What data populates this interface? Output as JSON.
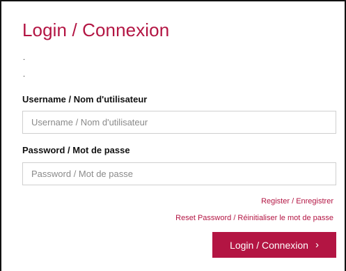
{
  "login": {
    "title": "Login / Connexion",
    "dots": [
      ".",
      "."
    ],
    "username": {
      "label": "Username / Nom d'utilisateur",
      "placeholder": "Username / Nom d'utilisateur",
      "value": ""
    },
    "password": {
      "label": "Password / Mot de passe",
      "placeholder": "Password / Mot de passe",
      "value": ""
    },
    "links": {
      "register": "Register / Enregistrer",
      "reset": "Reset Password / Réinitialiser le mot de passe"
    },
    "submit": {
      "label": "Login / Connexion",
      "icon": "chevron-right-icon",
      "glyph": "›"
    },
    "colors": {
      "accent": "#b31543",
      "border": "#111111"
    }
  }
}
